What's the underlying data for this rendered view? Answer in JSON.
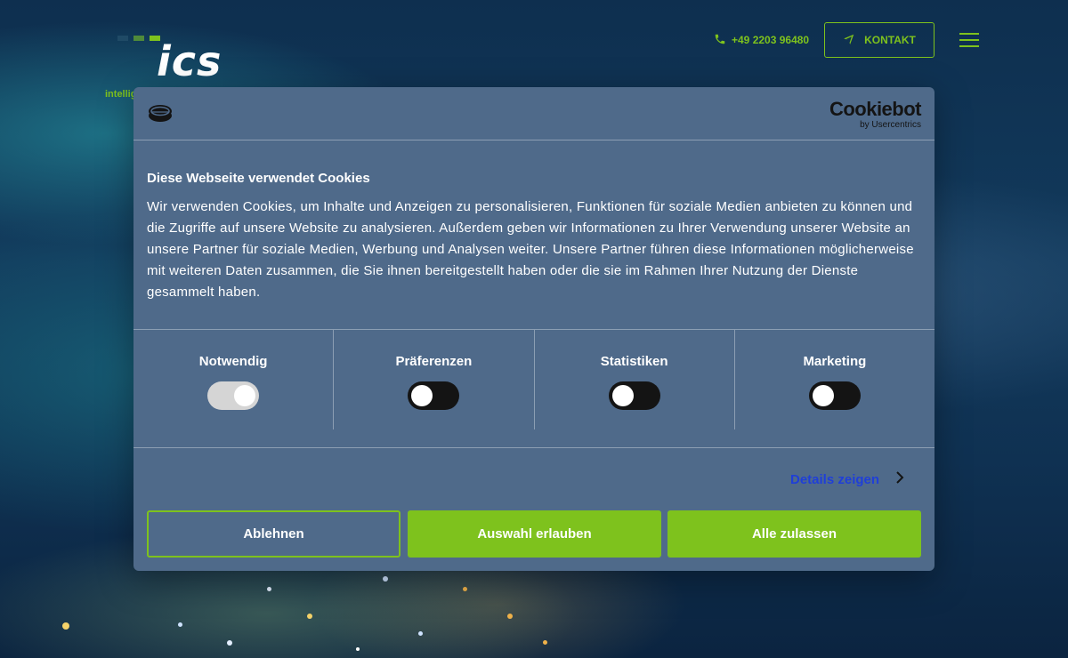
{
  "header": {
    "logo_text": "ics",
    "logo_tagline": "intellig",
    "phone": "+49 2203 96480",
    "kontakt_label": "KONTAKT",
    "accent_color": "#7ec21d",
    "icons": {
      "phone": "phone-icon",
      "kontakt": "paper-plane-icon",
      "menu": "hamburger-menu-icon"
    }
  },
  "dialog": {
    "brand": {
      "name": "Cookiebot",
      "byline": "by Usercentrics"
    },
    "title": "Diese Webseite verwendet Cookies",
    "body": "Wir verwenden Cookies, um Inhalte und Anzeigen zu personalisieren, Funktionen für soziale Medien anbieten zu können und die Zugriffe auf unsere Website zu analysieren. Außerdem geben wir Informationen zu Ihrer Verwendung unserer Website an unsere Partner für soziale Medien, Werbung und Analysen weiter. Unsere Partner führen diese Informationen möglicherweise mit weiteren Daten zusammen, die Sie ihnen bereitgestellt haben oder die sie im Rahmen Ihrer Nutzung der Dienste gesammelt haben.",
    "categories": [
      {
        "label": "Notwendig",
        "enabled": true
      },
      {
        "label": "Präferenzen",
        "enabled": false
      },
      {
        "label": "Statistiken",
        "enabled": false
      },
      {
        "label": "Marketing",
        "enabled": false
      }
    ],
    "details_link": "Details zeigen",
    "buttons": {
      "decline": "Ablehnen",
      "allow_selection": "Auswahl erlauben",
      "allow_all": "Alle zulassen"
    },
    "colors": {
      "panel": "#4f6a8a",
      "button_green": "#7ec21d",
      "link_blue": "#1f3fd8"
    }
  }
}
